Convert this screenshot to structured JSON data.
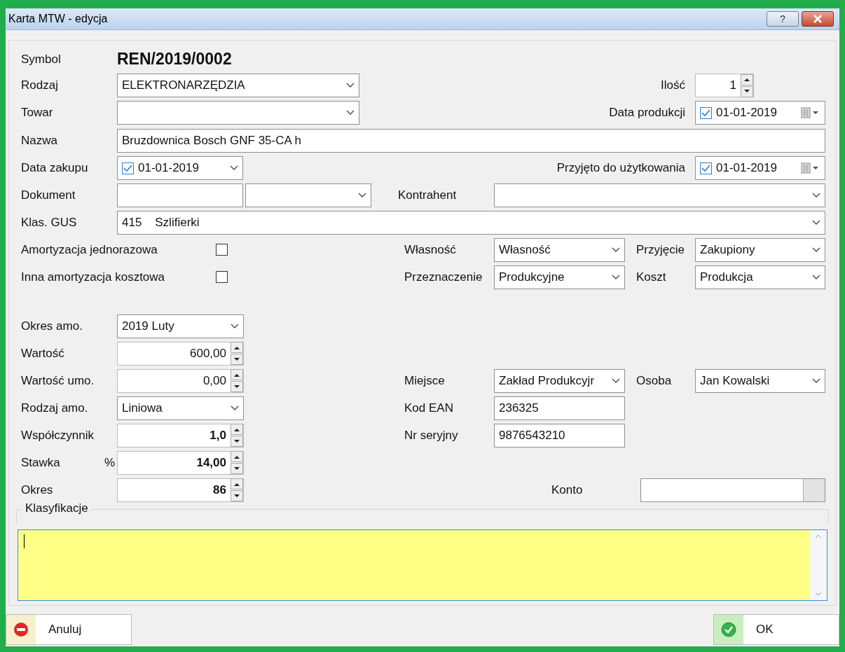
{
  "window": {
    "title": "Karta MTW - edycja",
    "help": "?"
  },
  "symbol": {
    "label": "Symbol",
    "value": "REN/2019/0002"
  },
  "rodzaj": {
    "label": "Rodzaj",
    "value": "ELEKTRONARZĘDZIA"
  },
  "ilosc": {
    "label": "Ilość",
    "value": "1"
  },
  "towar": {
    "label": "Towar"
  },
  "data_produkcji": {
    "label": "Data produkcji",
    "value": "01-01-2019",
    "checked": true
  },
  "nazwa": {
    "label": "Nazwa",
    "value": "Bruzdownica Bosch GNF 35-CA h"
  },
  "data_zakupu": {
    "label": "Data zakupu",
    "value": "01-01-2019",
    "checked": true
  },
  "przyjeto": {
    "label": "Przyjęto do użytkowania",
    "value": "01-01-2019",
    "checked": true
  },
  "dokument": {
    "label": "Dokument"
  },
  "kontrahent": {
    "label": "Kontrahent"
  },
  "klas_gus": {
    "label": "Klas. GUS",
    "code": "415",
    "name": "Szlifierki"
  },
  "amortyzacja_jednorazowa": {
    "label": "Amortyzacja jednorazowa",
    "checked": false
  },
  "inna_amortyzacja": {
    "label": "Inna amortyzacja kosztowa",
    "checked": false
  },
  "wlasnosc": {
    "label": "Własność",
    "value": "Własność"
  },
  "przyjecie": {
    "label": "Przyjęcie",
    "value": "Zakupiony"
  },
  "przeznaczenie": {
    "label": "Przeznaczenie",
    "value": "Produkcyjne"
  },
  "koszt": {
    "label": "Koszt",
    "value": "Produkcja"
  },
  "okres_amo": {
    "label": "Okres amo.",
    "value": "2019 Luty"
  },
  "wartosc": {
    "label": "Wartość",
    "value": "600,00"
  },
  "wartosc_umo": {
    "label": "Wartość umo.",
    "value": "0,00"
  },
  "rodzaj_amo": {
    "label": "Rodzaj amo.",
    "value": "Liniowa"
  },
  "wspolczynnik": {
    "label": "Współczynnik",
    "value": "1,0"
  },
  "stawka": {
    "label": "Stawka",
    "unit": "%",
    "value": "14,00"
  },
  "okres": {
    "label": "Okres",
    "value": "86"
  },
  "miejsce": {
    "label": "Miejsce",
    "value": "Zakład Produkcyjr"
  },
  "osoba": {
    "label": "Osoba",
    "value": "Jan Kowalski"
  },
  "kod_ean": {
    "label": "Kod EAN",
    "value": "236325"
  },
  "nr_seryjny": {
    "label": "Nr seryjny",
    "value": "9876543210"
  },
  "konto": {
    "label": "Konto"
  },
  "klasyfikacje": {
    "label": "Klasyfikacje"
  },
  "buttons": [
    {
      "label": "Anuluj",
      "kind": "cancel"
    },
    {
      "label": "OK",
      "kind": "ok"
    }
  ]
}
